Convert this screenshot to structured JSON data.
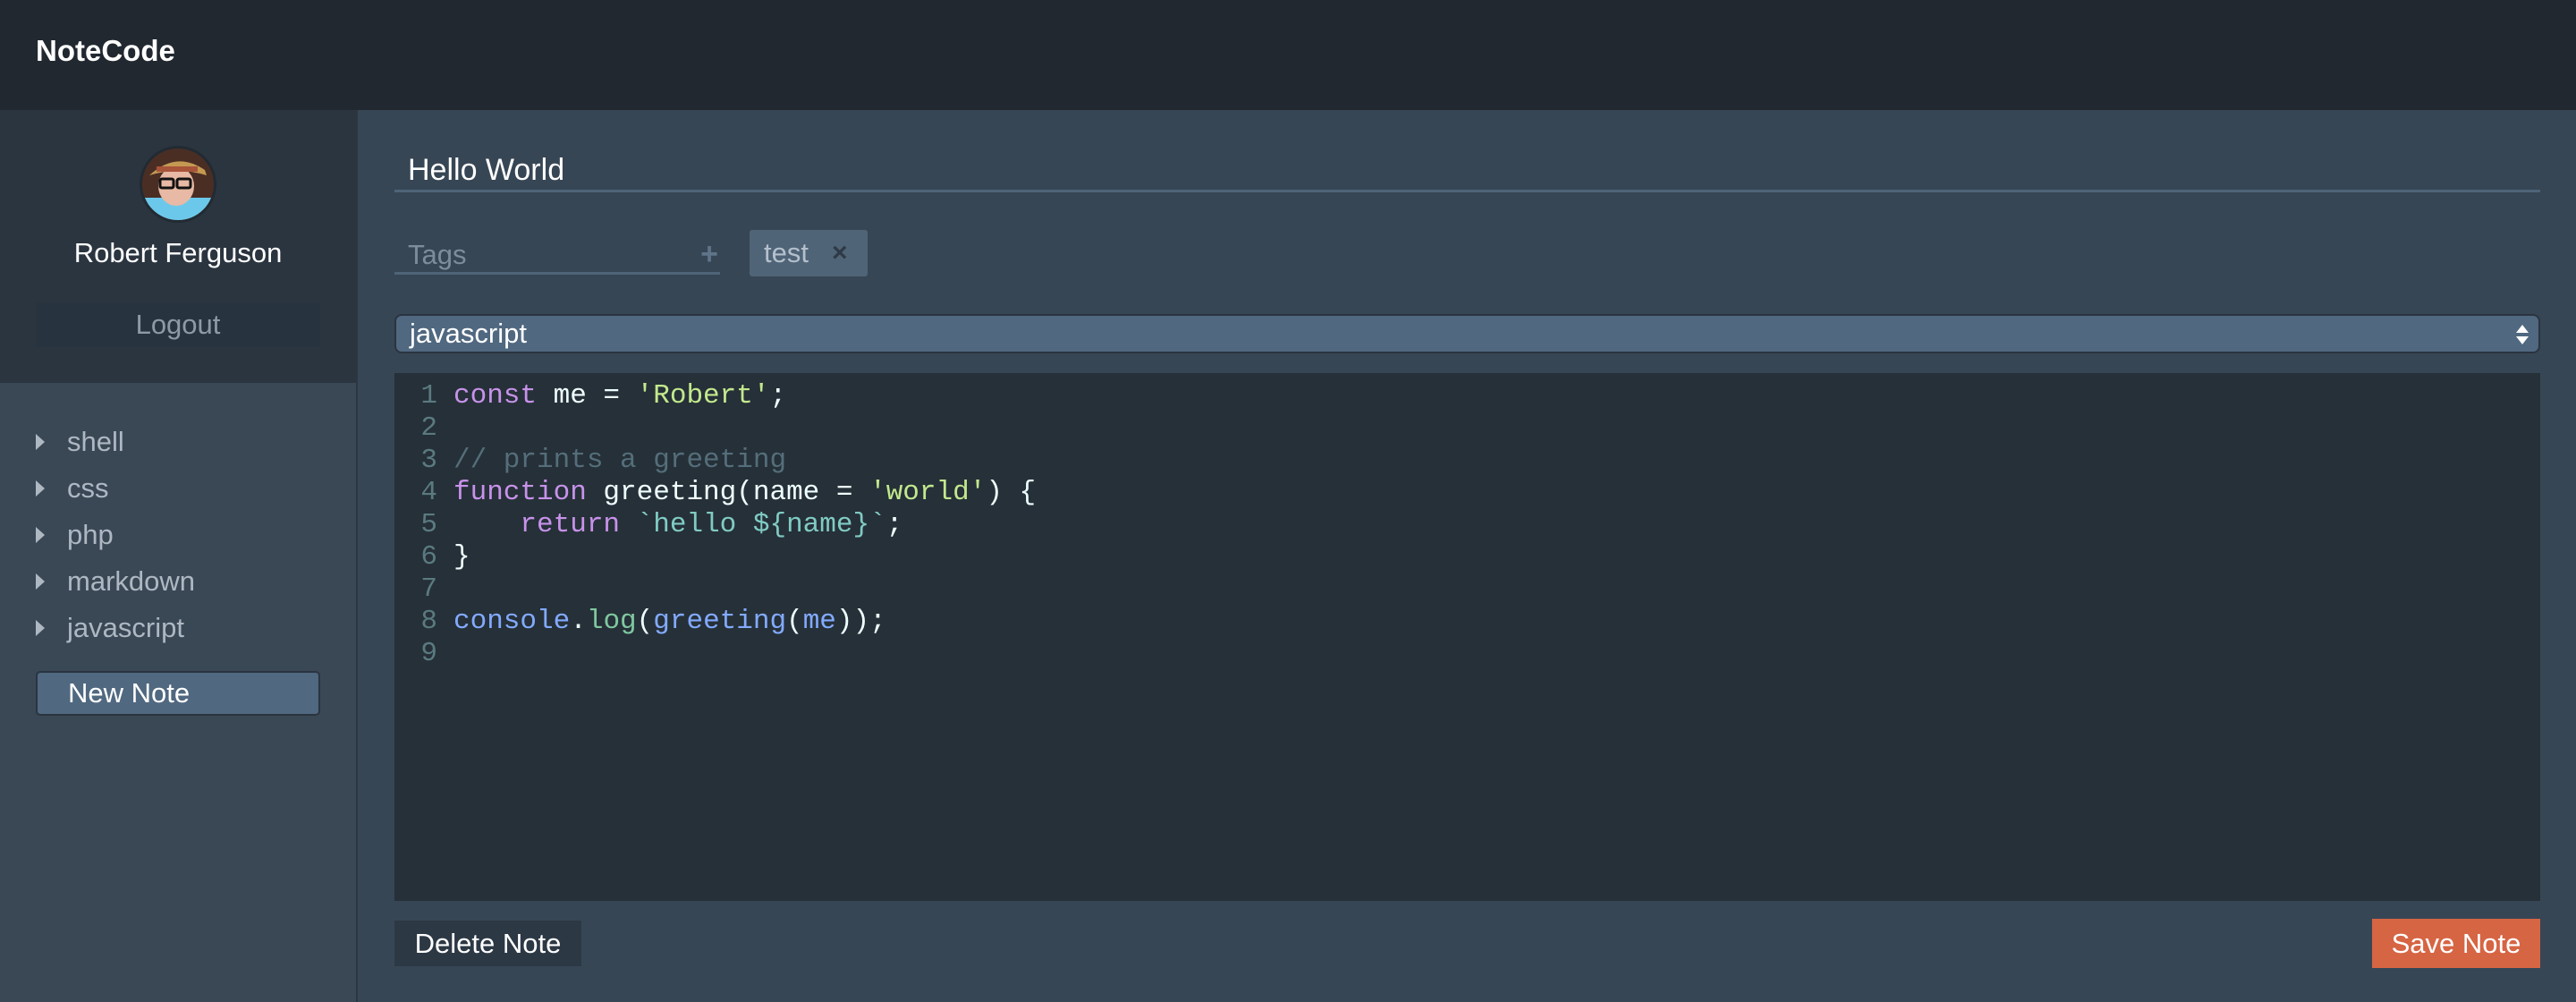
{
  "app": {
    "title": "NoteCode"
  },
  "user": {
    "name": "Robert Ferguson",
    "logout_label": "Logout"
  },
  "sidebar": {
    "items": [
      {
        "label": "shell"
      },
      {
        "label": "css"
      },
      {
        "label": "php"
      },
      {
        "label": "markdown"
      },
      {
        "label": "javascript"
      }
    ],
    "new_note_label": "New Note"
  },
  "note": {
    "title": "Hello World",
    "tags_placeholder": "Tags",
    "tags": [
      {
        "label": "test",
        "remove_icon": "×"
      }
    ],
    "language": "javascript",
    "code_lines": [
      {
        "n": "1",
        "tokens": [
          [
            "kw",
            "const"
          ],
          [
            "",
            " me = "
          ],
          [
            "str",
            "'Robert'"
          ],
          [
            "",
            ";"
          ]
        ]
      },
      {
        "n": "2",
        "tokens": []
      },
      {
        "n": "3",
        "tokens": [
          [
            "cm",
            "// prints a greeting"
          ]
        ]
      },
      {
        "n": "4",
        "tokens": [
          [
            "kw",
            "function"
          ],
          [
            "",
            " greeting(name = "
          ],
          [
            "str",
            "'world'"
          ],
          [
            "",
            ") {"
          ]
        ]
      },
      {
        "n": "5",
        "tokens": [
          [
            "",
            "    "
          ],
          [
            "kw",
            "return"
          ],
          [
            "",
            " "
          ],
          [
            "tpl",
            "`hello ${name}`"
          ],
          [
            "",
            ";"
          ]
        ]
      },
      {
        "n": "6",
        "tokens": [
          [
            "",
            "}"
          ]
        ]
      },
      {
        "n": "7",
        "tokens": []
      },
      {
        "n": "8",
        "tokens": [
          [
            "fn",
            "console"
          ],
          [
            "",
            "."
          ],
          [
            "prop",
            "log"
          ],
          [
            "",
            "("
          ],
          [
            "fn",
            "greeting"
          ],
          [
            "",
            "("
          ],
          [
            "fn",
            "me"
          ],
          [
            "",
            "));"
          ]
        ]
      },
      {
        "n": "9",
        "tokens": []
      }
    ]
  },
  "actions": {
    "delete_label": "Delete Note",
    "save_label": "Save Note"
  },
  "colors": {
    "accent": "#d66544",
    "header": "#212830",
    "editor_bg": "#263038"
  }
}
